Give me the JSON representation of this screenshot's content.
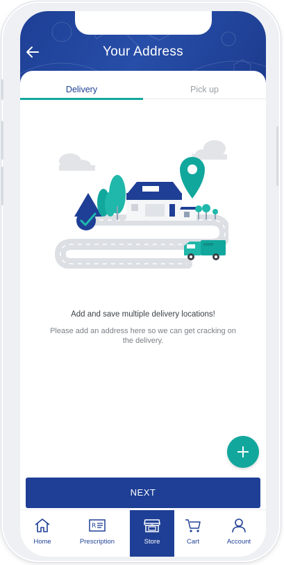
{
  "header": {
    "title": "Your Address"
  },
  "tabs": [
    {
      "label": "Delivery",
      "active": true
    },
    {
      "label": "Pick up",
      "active": false
    }
  ],
  "empty_state": {
    "title": "Add and save multiple delivery locations!",
    "description": "Please add an address here so we can get cracking on the delivery."
  },
  "actions": {
    "next_label": "NEXT",
    "add_icon": "plus-icon"
  },
  "nav": {
    "items": [
      {
        "label": "Home",
        "icon": "home-icon",
        "active": false
      },
      {
        "label": "Prescription",
        "icon": "prescription-icon",
        "active": false
      },
      {
        "label": "Store",
        "icon": "store-icon",
        "active": true
      },
      {
        "label": "Cart",
        "icon": "cart-icon",
        "active": false
      },
      {
        "label": "Account",
        "icon": "account-icon",
        "active": false
      }
    ]
  },
  "colors": {
    "brand_blue": "#1e3f95",
    "accent_teal": "#12a79d",
    "text_dark": "#3a3f45",
    "text_muted": "#7b8087"
  }
}
